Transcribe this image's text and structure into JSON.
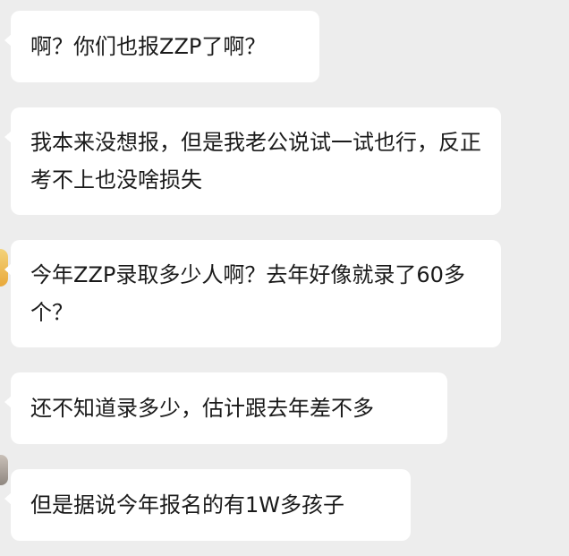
{
  "chat": {
    "messages": [
      {
        "text": "啊？你们也报ZZP了啊？"
      },
      {
        "text": "我本来没想报，但是我老公说试一试也行，反正考不上也没啥损失"
      },
      {
        "text": "今年ZZP录取多少人啊？去年好像就录了60多个？"
      },
      {
        "text": "还不知道录多少，估计跟去年差不多"
      },
      {
        "text": "但是据说今年报名的有1W多孩子"
      }
    ]
  },
  "colors": {
    "background": "#ededed",
    "bubble": "#ffffff",
    "text": "#1a1a1a"
  }
}
